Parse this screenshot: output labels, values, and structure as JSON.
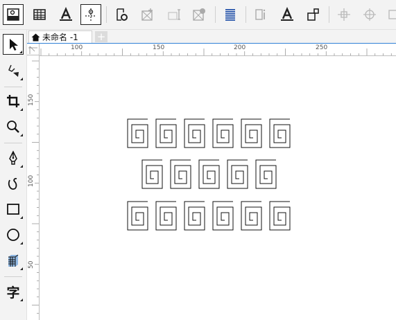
{
  "toolbar": {
    "icons": [
      "ruler-options-icon",
      "grid-icon",
      "text-style-icon",
      "guideline-icon",
      "object-settings-icon",
      "insert-image-icon",
      "barcode-icon",
      "frame-icon",
      "paragraph-align-icon",
      "text-properties-icon",
      "char-format-icon",
      "shape-icon",
      "align-center-icon",
      "snap-target-icon",
      "more-icon"
    ]
  },
  "toolbox": {
    "tools": [
      "pick-tool-icon",
      "shape-edit-tool-icon",
      "crop-tool-icon",
      "zoom-tool-icon",
      "pen-tool-icon",
      "bezier-tool-icon",
      "rectangle-tool-icon",
      "ellipse-tool-icon",
      "table-tool-icon",
      "text-tool-icon"
    ],
    "text_tool_label": "字"
  },
  "document": {
    "tab_label": "未命名 -1",
    "add_tab_label": "+"
  },
  "rulers": {
    "horizontal_labels": [
      "100",
      "150",
      "200",
      "250"
    ],
    "vertical_labels": [
      "150",
      "100",
      "50"
    ]
  },
  "canvas": {
    "rows": [
      6,
      5,
      6
    ],
    "shape": "square-spiral"
  },
  "colors": {
    "accent": "#2f7fd6",
    "active_icon": "#1f4fa8"
  }
}
